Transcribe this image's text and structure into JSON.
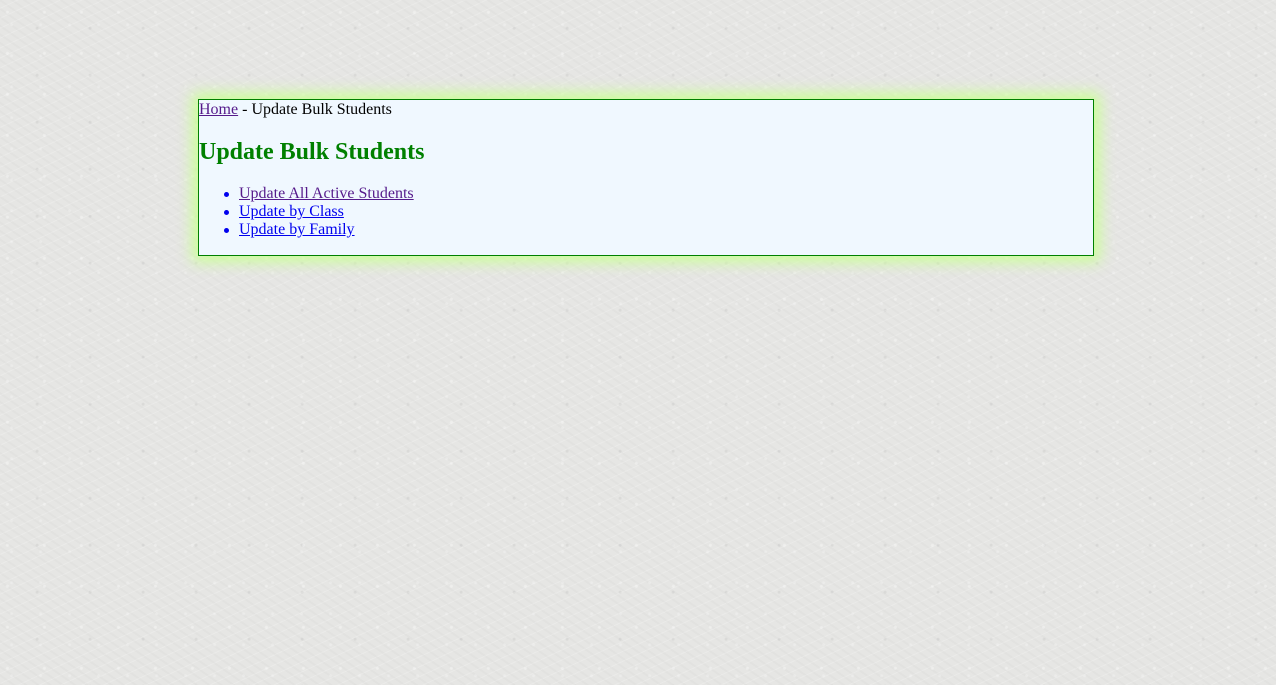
{
  "breadcrumb": {
    "home_label": "Home",
    "separator": " - ",
    "current": "Update Bulk Students"
  },
  "page": {
    "title": "Update Bulk Students"
  },
  "links": [
    {
      "label": "Update All Active Students",
      "visited": true
    },
    {
      "label": "Update by Class",
      "visited": false
    },
    {
      "label": "Update by Family",
      "visited": false
    }
  ],
  "colors": {
    "title": "#008000",
    "panel_border": "#008000",
    "panel_background": "#f0f8ff",
    "panel_glow": "#ccff99",
    "link": "#0000ee",
    "link_visited": "#551a8b"
  }
}
